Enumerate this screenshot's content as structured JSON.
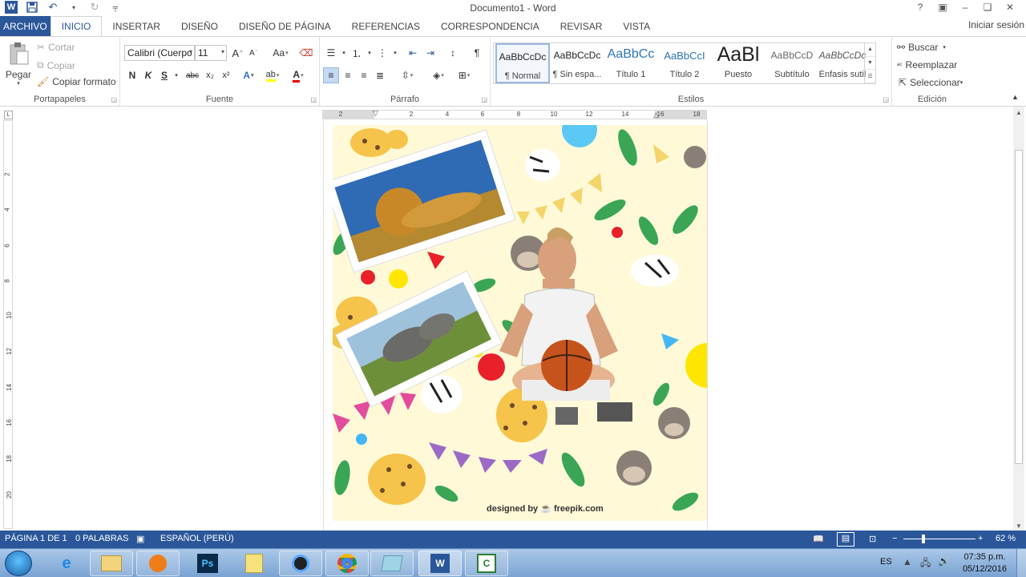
{
  "app": {
    "title": "Documento1 - Word",
    "brand_color": "#2b579a",
    "window_buttons": [
      "?",
      "▣",
      "–",
      "❏",
      "✕"
    ]
  },
  "quick_access": {
    "icons": [
      "word-logo-icon",
      "save-icon",
      "undo-icon",
      "redo-icon",
      "customize-icon"
    ]
  },
  "tabs": [
    {
      "label": "ARCHIVO"
    },
    {
      "label": "INICIO"
    },
    {
      "label": "INSERTAR"
    },
    {
      "label": "DISEÑO"
    },
    {
      "label": "DISEÑO DE PÁGINA"
    },
    {
      "label": "REFERENCIAS"
    },
    {
      "label": "CORRESPONDENCIA"
    },
    {
      "label": "REVISAR"
    },
    {
      "label": "VISTA"
    }
  ],
  "sign_in": "Iniciar sesión",
  "clipboard": {
    "label": "Portapapeles",
    "paste": "Pegar",
    "cut": "Cortar",
    "copy": "Copiar",
    "format_painter": "Copiar formato"
  },
  "font": {
    "label": "Fuente",
    "family": "Calibri (Cuerpo",
    "size": "11",
    "bold": "N",
    "italic": "K",
    "underline": "S",
    "strike": "abc",
    "subscript": "x₂",
    "superscript": "x²",
    "grow": "A",
    "shrink": "A",
    "case": "Aa"
  },
  "paragraph": {
    "label": "Párrafo",
    "pilcrow": "¶"
  },
  "styles": {
    "label": "Estilos",
    "items": [
      {
        "preview": "AaBbCcDc",
        "name": "¶ Normal"
      },
      {
        "preview": "AaBbCcDc",
        "name": "¶ Sin espa..."
      },
      {
        "preview": "AaBbCc",
        "name": "Título 1"
      },
      {
        "preview": "AaBbCcI",
        "name": "Título 2"
      },
      {
        "preview": "AaBl",
        "name": "Puesto"
      },
      {
        "preview": "AaBbCcD",
        "name": "Subtítulo"
      },
      {
        "preview": "AaBbCcDc",
        "name": "Énfasis sutil"
      }
    ]
  },
  "editing": {
    "label": "Edición",
    "find": "Buscar",
    "replace": "Reemplazar",
    "select": "Seleccionar"
  },
  "ruler": {
    "h_ticks": [
      "2",
      "2",
      "4",
      "6",
      "8",
      "10",
      "12",
      "14",
      "16",
      "18"
    ],
    "v_ticks": [
      "2",
      "4",
      "6",
      "8",
      "10",
      "12",
      "14",
      "16",
      "18",
      "20"
    ]
  },
  "page": {
    "credit": "designed by ☕ freepik.com"
  },
  "status": {
    "page": "PÁGINA 1 DE 1",
    "words": "0 PALABRAS",
    "language": "ESPAÑOL (PERÚ)",
    "zoom": "62 %",
    "zoom_minus": "−",
    "zoom_plus": "+"
  },
  "taskbar": {
    "apps": [
      "internet-explorer-icon",
      "file-explorer-icon",
      "media-player-icon",
      "photoshop-icon",
      "notes-icon",
      "camera-icon",
      "chrome-icon",
      "app-icon",
      "word-icon",
      "camtasia-icon"
    ],
    "lang": "ES",
    "time": "07:35 p.m.",
    "date": "05/12/2016"
  }
}
